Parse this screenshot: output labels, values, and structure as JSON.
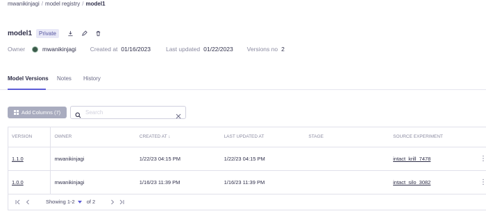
{
  "breadcrumb": {
    "items": [
      "mwanikinjagi",
      "model registry"
    ],
    "current": "model1",
    "separator": "/"
  },
  "model": {
    "name": "model1",
    "visibility": "Private",
    "icons": [
      "download-icon",
      "edit-icon",
      "delete-icon"
    ]
  },
  "meta": {
    "owner_label": "Owner",
    "owner_value": "mwanikinjagi",
    "created_label": "Created at",
    "created_value": "01/16/2023",
    "updated_label": "Last updated",
    "updated_value": "01/22/2023",
    "versions_label": "Versions no",
    "versions_value": "2"
  },
  "tabs": [
    {
      "label": "Model Versions",
      "active": true
    },
    {
      "label": "Notes",
      "active": false
    },
    {
      "label": "History",
      "active": false
    }
  ],
  "toolbar": {
    "add_columns_label": "Add Columns (7)",
    "search_placeholder": "Search",
    "search_value": ""
  },
  "table": {
    "columns": [
      "VERSION",
      "OWNER",
      "CREATED AT ↓",
      "LAST UPDATED AT",
      "STAGE",
      "SOURCE EXPERIMENT"
    ],
    "rows": [
      {
        "version": "1.1.0",
        "owner": "mwanikinjagi",
        "created": "1/22/23 04:15 PM",
        "updated": "1/22/23 04:15 PM",
        "stage": "",
        "experiment": "intact_krill_7478"
      },
      {
        "version": "1.0.0",
        "owner": "mwanikinjagi",
        "created": "1/16/23 11:39 PM",
        "updated": "1/16/23 11:39 PM",
        "stage": "",
        "experiment": "intact_silo_3082"
      }
    ]
  },
  "pager": {
    "showing": "Showing 1-2",
    "of": "of 2"
  },
  "colors": {
    "accent": "#5b5bd6",
    "badge_bg": "#e8e8f7",
    "button_disabled": "#a9acbf"
  }
}
